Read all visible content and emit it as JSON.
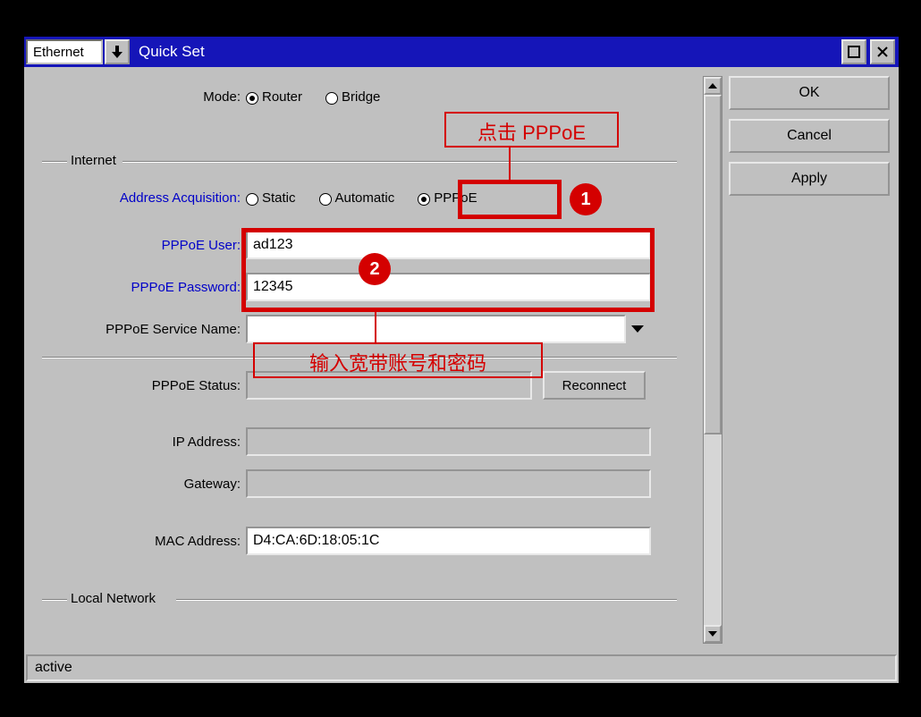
{
  "titlebar": {
    "combo_value": "Ethernet",
    "title": "Quick Set"
  },
  "buttons": {
    "ok": "OK",
    "cancel": "Cancel",
    "apply": "Apply"
  },
  "mode": {
    "label": "Mode:",
    "router": "Router",
    "bridge": "Bridge"
  },
  "groups": {
    "internet": "Internet",
    "local_network": "Local Network"
  },
  "internet": {
    "addr_acq_label": "Address Acquisition:",
    "static": "Static",
    "automatic": "Automatic",
    "pppoe": "PPPoE",
    "pppoe_user_label": "PPPoE User:",
    "pppoe_user_value": "ad123",
    "pppoe_password_label": "PPPoE Password:",
    "pppoe_password_value": "12345",
    "pppoe_servicename_label": "PPPoE Service Name:",
    "pppoe_servicename_value": "",
    "pppoe_status_label": "PPPoE Status:",
    "pppoe_status_value": "",
    "reconnect": "Reconnect",
    "ip_address_label": "IP Address:",
    "ip_address_value": "",
    "gateway_label": "Gateway:",
    "gateway_value": "",
    "mac_address_label": "MAC Address:",
    "mac_address_value": "D4:CA:6D:18:05:1C"
  },
  "status": "active",
  "annotations": {
    "click_pppoe": "点击 PPPoE",
    "badge1": "1",
    "badge2": "2",
    "enter_account": "输入宽带账号和密码"
  }
}
